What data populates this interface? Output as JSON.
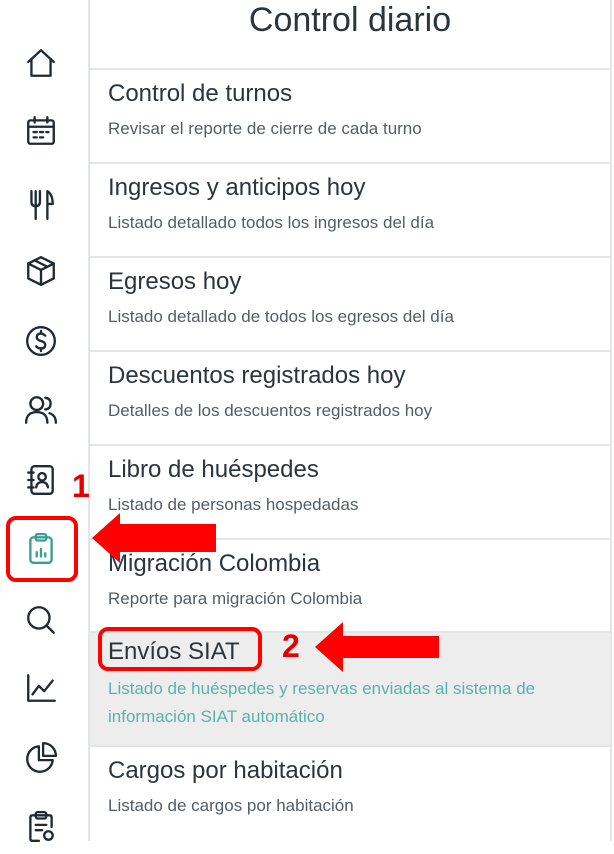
{
  "nav": {
    "items": [
      {
        "id": "home",
        "icon": "home-icon"
      },
      {
        "id": "calendar",
        "icon": "calendar-icon"
      },
      {
        "id": "restaurant",
        "icon": "fork-knife-icon"
      },
      {
        "id": "products",
        "icon": "box-icon"
      },
      {
        "id": "payments",
        "icon": "dollar-circle-icon"
      },
      {
        "id": "guests",
        "icon": "users-icon"
      },
      {
        "id": "contacts",
        "icon": "contacts-book-icon"
      },
      {
        "id": "daily-control",
        "icon": "clipboard-chart-icon",
        "active": true
      },
      {
        "id": "search",
        "icon": "search-icon"
      },
      {
        "id": "reports",
        "icon": "line-chart-icon"
      },
      {
        "id": "stats",
        "icon": "pie-chart-icon"
      },
      {
        "id": "tasks",
        "icon": "clipboard-settings-icon"
      }
    ],
    "active_color": "#3a9e93"
  },
  "main": {
    "title": "Control diario",
    "items": [
      {
        "title": "Control de turnos",
        "description": "Revisar el reporte de cierre de cada turno"
      },
      {
        "title": "Ingresos y anticipos hoy",
        "description": "Listado detallado todos los ingresos del día"
      },
      {
        "title": "Egresos hoy",
        "description": "Listado detallado de todos los egresos del día"
      },
      {
        "title": "Descuentos registrados hoy",
        "description": "Detalles de los descuentos registrados hoy"
      },
      {
        "title": "Libro de huéspedes",
        "description": "Listado de personas hospedadas"
      },
      {
        "title": "Migración Colombia",
        "description": "Reporte para migración Colombia"
      },
      {
        "title": "Envíos SIAT",
        "description": "Listado de huéspedes y reservas enviadas al sistema de información SIAT automático",
        "selected": true
      },
      {
        "title": "Cargos por habitación",
        "description": "Listado de cargos por habitación"
      }
    ]
  },
  "annotations": {
    "step1": "1",
    "step2": "2",
    "color": "#ff0000"
  }
}
